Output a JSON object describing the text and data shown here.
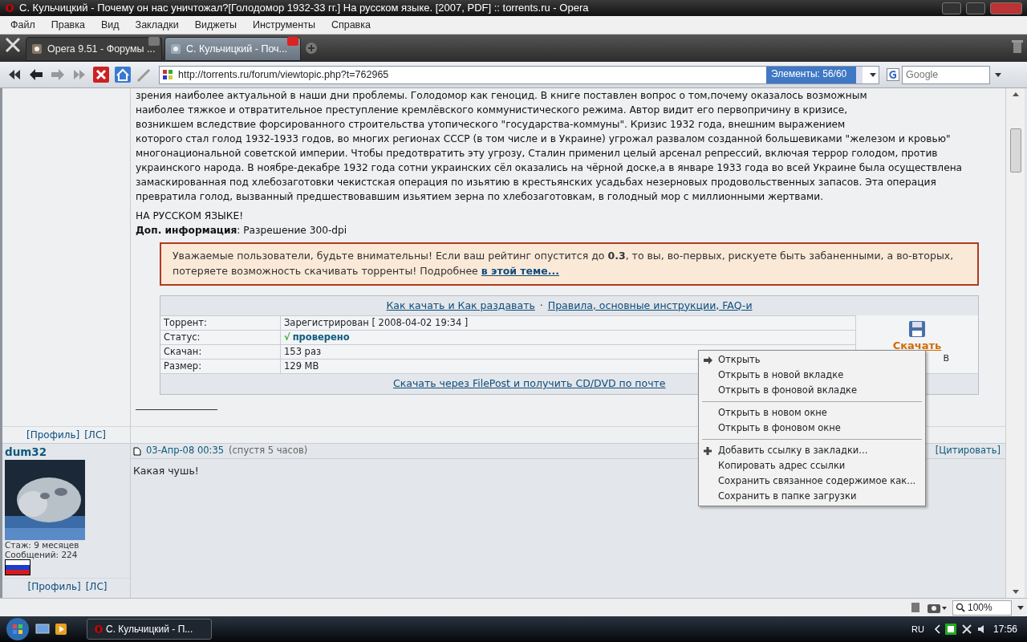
{
  "window": {
    "title": "С. Кульчицкий - Почему он нас уничтожал?[Голодомор 1932-33 гг.] На русском языке. [2007, PDF] :: torrents.ru - Opera"
  },
  "menu": [
    "Файл",
    "Правка",
    "Вид",
    "Закладки",
    "Виджеты",
    "Инструменты",
    "Справка"
  ],
  "tabs": [
    {
      "label": "Opera 9.51 - Форумы ...",
      "selected": false
    },
    {
      "label": "С. Кульчицкий - Поч...",
      "selected": true
    }
  ],
  "address": {
    "url": "http://torrents.ru/forum/viewtopic.php?t=762965",
    "progress_text": "Элементы:  56/60",
    "level": 0.93
  },
  "search": {
    "placeholder": "Google"
  },
  "post": {
    "lines": [
      "зрения наиболее актуальной в наши дни проблемы. Голодомор как геноцид. В книге поставлен вопрос о том,почему оказалось возможным",
      "наиболее тяжкое и отвратительное преступление кремлёвского коммунистического режима. Автор видит его первопричину в кризисе,",
      "возникшем вследствие форсированного строительства утопического \"государства-коммуны\". Кризис 1932 года, внешним выражением",
      "которого стал голод 1932-1933 годов, во многих регионах СССР (в том числе и в Украине) угрожал развалом созданной большевиками \"железом и кровью\"",
      "многонациональной советской империи. Чтобы предотвратить эту угрозу, Сталин применил целый арсенал репрессий, включая террор голодом, против",
      "украинского народа. В ноябре-декабре 1932 года сотни украинских сёл оказались на чёрной доске,а в январе 1933 года во всей Украине была осуществлена",
      "замаскированная под хлебозаготовки чекистская операция по изьятию в крестьянских усадьбах незерновых продовольственных запасов. Эта операция",
      "превратила голод, вызванный предшествовавшим изьятием зерна по хлебозаготовкам, в голодный мор с миллионными жертвами."
    ],
    "lang_note": "НА РУССКОМ ЯЗЫКЕ!",
    "info": "**Доп. информация**: Разрешение 300-dpi"
  },
  "warning": {
    "text": "Уважаемые пользователи, будьте внимательны! Если ваш рейтинг опустится до **0.3**, то вы, во-первых, рискуете быть забаненными, а во-вторых, потеряете возможность скачивать торренты! Подробнее",
    "link": "в этой теме..."
  },
  "torrent": {
    "links": [
      "Как качать и Как раздавать",
      "Правила, основные инструкции, FAQ-и"
    ],
    "separator": "·",
    "rows": [
      {
        "label": "Торрент:",
        "value": "Зарегистрирован  [ 2008-04-02 19:34 ]",
        "kind": "text"
      },
      {
        "label": "Статус:",
        "value": "проверено",
        "kind": "status",
        "mark": "√"
      },
      {
        "label": "Скачан:",
        "value": "153 раз",
        "kind": "text"
      },
      {
        "label": "Размер:",
        "value": "129 MB",
        "kind": "text"
      }
    ],
    "download": "Скачать",
    "download_size": "B",
    "filepost": "Скачать через FilePost и получить CD/DVD по почте"
  },
  "author_links": [
    "[Профиль]",
    "[ЛС]"
  ],
  "reply": {
    "user": "dum32",
    "date": "03-Апр-08 00:35",
    "ago": "(спустя 5 часов)",
    "quote": "[Цитировать]",
    "body": "Какая чушь!",
    "stats": [
      "Стаж: 9 месяцев",
      "Сообщений: 224"
    ],
    "links": [
      "[Профиль]",
      "[ЛС]"
    ]
  },
  "context_menu": [
    {
      "label": "Открыть",
      "kind": "default"
    },
    {
      "label": "Открыть в новой вкладке",
      "kind": "item"
    },
    {
      "label": "Открыть в фоновой вкладке",
      "kind": "item"
    },
    {
      "kind": "separator"
    },
    {
      "label": "Открыть в новом окне",
      "kind": "item"
    },
    {
      "label": "Открыть в фоновом окне",
      "kind": "item"
    },
    {
      "kind": "separator"
    },
    {
      "label": "Добавить ссылку в закладки...",
      "kind": "add"
    },
    {
      "label": "Копировать адрес ссылки",
      "kind": "item"
    },
    {
      "label": "Сохранить связанное содержимое как...",
      "kind": "item"
    },
    {
      "label": "Сохранить в папке загрузки",
      "kind": "item"
    }
  ],
  "status_bar": {
    "zoom": "100%"
  },
  "taskbar": {
    "task": "С. Кульчицкий - П...",
    "lang": "RU",
    "time": "17:56"
  }
}
